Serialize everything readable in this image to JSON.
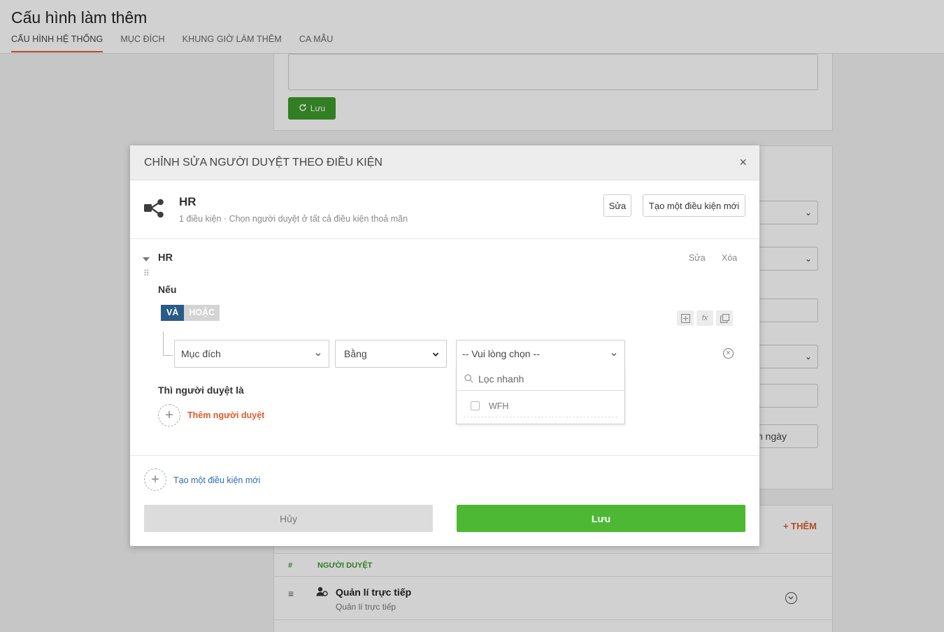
{
  "page": {
    "title": "Cấu hình làm thêm",
    "tabs": [
      {
        "label": "CẤU HÌNH HỆ THỐNG",
        "active": true
      },
      {
        "label": "MỤC ĐÍCH",
        "active": false
      },
      {
        "label": "KHUNG GIỜ LÀM THÊM",
        "active": false
      },
      {
        "label": "CA MẪU",
        "active": false
      }
    ]
  },
  "background": {
    "save_label": "Lưu",
    "days_suffix": "n ngày",
    "add_label": "THÊM",
    "table_headers": {
      "index": "#",
      "approver": "NGƯỜI DUYỆT"
    },
    "rows": [
      {
        "title": "Quản lí trực tiếp",
        "subtitle": "Quản lí trực tiếp"
      }
    ]
  },
  "modal": {
    "title": "CHỈNH SỬA NGƯỜI DUYỆT THEO ĐIỀU KIỆN",
    "close_icon": "×",
    "group": {
      "name": "HR",
      "description": "1 điều kiện · Chọn người duyệt ở tất cả điều kiện thoả mãn",
      "edit_label": "Sửa",
      "new_condition_label": "Tạo một điều kiện mới"
    },
    "condition": {
      "name": "HR",
      "edit_label": "Sửa",
      "delete_label": "Xóa",
      "if_label": "Nếu",
      "logic_and": "VÀ",
      "logic_or": "HOẶC",
      "field": "Mục đích",
      "operator": "Bằng",
      "value_placeholder": "-- Vui lòng chọn --",
      "search_placeholder": "Lọc nhanh",
      "options": [
        "WFH"
      ],
      "then_label": "Thì người duyệt là",
      "add_approver": "Thêm người duyệt"
    },
    "add_condition": "Tạo một điều kiện mới",
    "cancel_label": "Hủy",
    "save_label": "Lưu"
  },
  "colors": {
    "accent": "#e05a2b",
    "save_green": "#4db833",
    "and_blue": "#2a5a86",
    "link_blue": "#2a6db5"
  }
}
